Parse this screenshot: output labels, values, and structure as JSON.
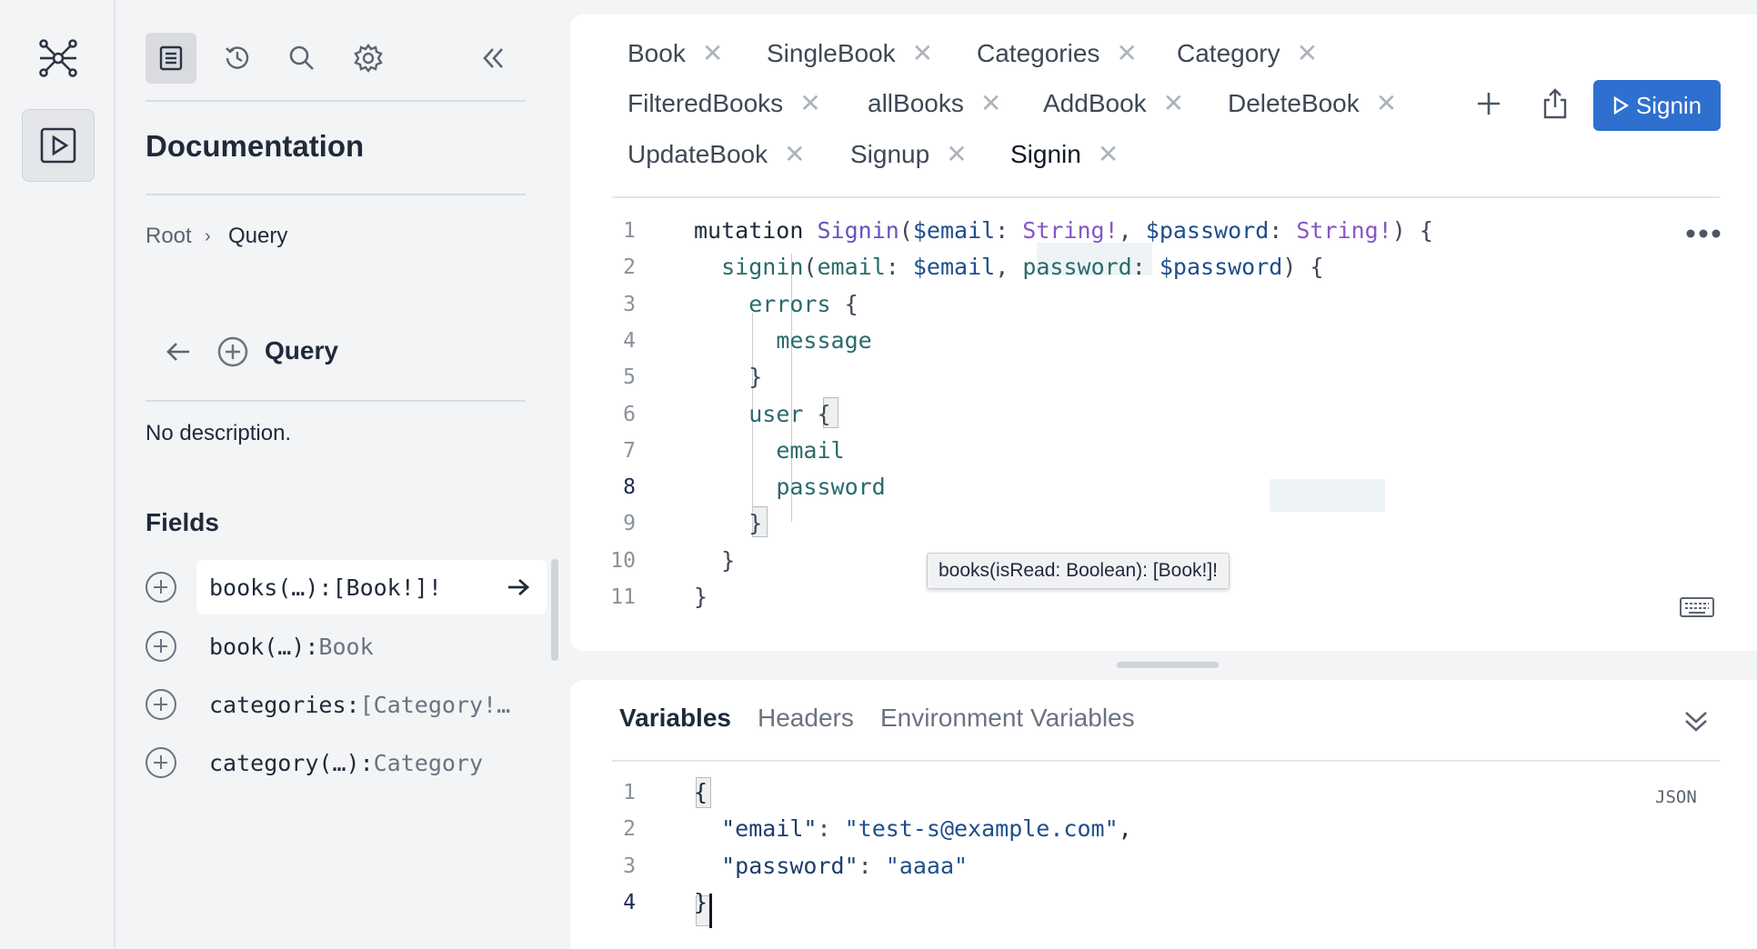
{
  "rail": {
    "items": [
      {
        "icon": "graph-icon",
        "active": false
      },
      {
        "icon": "play-icon",
        "active": true
      }
    ]
  },
  "docs": {
    "toolbar": [
      "docs-icon",
      "history-icon",
      "search-icon",
      "settings-icon",
      "collapse-icon"
    ],
    "title": "Documentation",
    "breadcrumb": [
      "Root",
      "Query"
    ],
    "breadcrumb_sep": "›",
    "type_title": "Query",
    "description": "No description.",
    "fields_heading": "Fields",
    "fields": [
      {
        "name": "books(…): ",
        "type": "[Book!]!",
        "type_dark": true,
        "highlighted": true
      },
      {
        "name": "book(…): ",
        "type": "Book",
        "type_dark": false,
        "highlighted": false
      },
      {
        "name": "categories: ",
        "type": "[Category!…",
        "type_dark": false,
        "highlighted": false
      },
      {
        "name": "category(…): ",
        "type": "Category",
        "type_dark": false,
        "highlighted": false
      }
    ]
  },
  "editor": {
    "tabs": [
      [
        "Book",
        "SingleBook",
        "Categories",
        "Category"
      ],
      [
        "FilteredBooks",
        "allBooks",
        "AddBook",
        "DeleteBook"
      ],
      [
        "UpdateBook",
        "Signup",
        "Signin"
      ]
    ],
    "active_tab": "Signin",
    "close_glyph": "✕",
    "run_button": "Signin",
    "code_lines": [
      "mutation Signin($email: String!, $password: String!) {",
      "  signin(email: $email, password: $password) {",
      "    errors {",
      "      message",
      "    }",
      "    user {",
      "      email",
      "      password",
      "    }",
      "  }",
      "}"
    ],
    "line_numbers": [
      "1",
      "2",
      "3",
      "4",
      "5",
      "6",
      "7",
      "8",
      "9",
      "10",
      "11"
    ],
    "current_line": "8",
    "tooltip": "books(isRead: Boolean): [Book!]!"
  },
  "variables": {
    "tabs": [
      "Variables",
      "Headers",
      "Environment Variables"
    ],
    "active_tab": "Variables",
    "badge": "JSON",
    "line_numbers": [
      "1",
      "2",
      "3",
      "4"
    ],
    "current_line": "4",
    "code_lines": [
      "{",
      "  \"email\": \"test-s@example.com\",",
      "  \"password\": \"aaaa\"",
      "}"
    ]
  },
  "colors": {
    "accent": "#2e6fd0",
    "background": "#f3f4f6",
    "panel": "#ffffff"
  }
}
